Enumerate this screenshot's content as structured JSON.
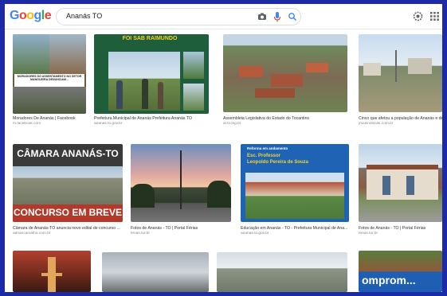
{
  "header": {
    "logo_letters": [
      {
        "char": "G",
        "color": "#4285f4"
      },
      {
        "char": "o",
        "color": "#ea4335"
      },
      {
        "char": "o",
        "color": "#fbbc05"
      },
      {
        "char": "g",
        "color": "#4285f4"
      },
      {
        "char": "l",
        "color": "#34a853"
      },
      {
        "char": "e",
        "color": "#ea4335"
      }
    ],
    "search_query": "Ananás TO",
    "icons": [
      "clear-icon",
      "mic-icon",
      "search-icon",
      "settings-icon",
      "apps-icon"
    ]
  },
  "results": [
    {
      "title": "Moradores De Ananás | Facebook",
      "source": "m.facebook.com",
      "overlay": "MORADORES DO ASSENTAMENTO NO SETOR MANGUEIRA DENUNCIAM..."
    },
    {
      "title": "Prefeitura Municipal de Ananás Prefeitura Ananás TO",
      "source": "ananas.to.gov.br",
      "overlay": "FOI SAB RAIMUNDO"
    },
    {
      "title": "Assembleia Legislativa do Estado do Tocantins",
      "source": "al.to.leg.br",
      "overlay": ""
    },
    {
      "title": "Cinco que afetou a população de Ananás e devem",
      "source": "jmaisnoticias.com.br",
      "overlay": ""
    },
    {
      "title": "Câmara de Ananás-TO anuncia novo edital de concurso ...",
      "source": "adriancarvalho.com.br",
      "overlay_top": "CÂMARA ANANÁS-TO",
      "overlay_bottom": "CONCURSO EM BREVE"
    },
    {
      "title": "Fotos de Ananás - TO | Portal Férias",
      "source": "ferias.tur.br",
      "overlay": ""
    },
    {
      "title": "Educação em Ananás - TO - Prefeitura Municipal de Ana...",
      "source": "ananas.to.gov.br",
      "overlay_top": "Reforma em andamento",
      "overlay_mid": "Esc. Professor",
      "overlay_bottom": "Leopoldo Pereira de Souza"
    },
    {
      "title": "Fotos de Ananás - TO | Portal Férias",
      "source": "ferias.tur.br",
      "overlay": ""
    },
    {
      "title": "",
      "source": "",
      "overlay": ""
    },
    {
      "title": "",
      "source": "",
      "overlay": ""
    },
    {
      "title": "",
      "source": "",
      "overlay": ""
    },
    {
      "title": "",
      "source": "",
      "overlay": "omprom..."
    }
  ],
  "colors": {
    "frame_border": "#1c2aa8",
    "green_banner": "#1f5e3a",
    "blue_banner": "#1e63b4",
    "yellow_text": "#f6d32a"
  }
}
